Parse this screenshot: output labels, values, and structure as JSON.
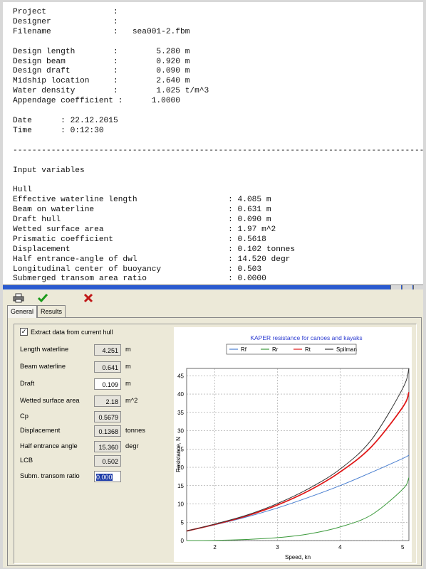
{
  "report": {
    "lines": [
      "Project              :",
      "Designer             :",
      "Filename             :   sea001-2.fbm",
      "",
      "Design length        :        5.280 m",
      "Design beam          :        0.920 m",
      "Design draft         :        0.090 m",
      "Midship location     :        2.640 m",
      "Water density        :        1.025 t/m^3",
      "Appendage coefficient :      1.0000",
      "",
      "Date      : 22.12.2015",
      "Time      : 0:12:30",
      "",
      "----------------------------------------------------------------------------------------------------",
      "",
      "Input variables",
      "",
      "Hull",
      "Effective waterline length                   : 4.085 m",
      "Beam on waterline                            : 0.631 m",
      "Draft hull                                   : 0.090 m",
      "Wetted surface area                          : 1.97 m^2",
      "Prismatic coefficient                        : 0.5618",
      "Displacement                                 : 0.102 tonnes",
      "Half entrance-angle of dwl                   : 14.520 degr",
      "Longitudinal center of buoyancy              : 0.503",
      "Submerged transom area ratio                 : 0.0000"
    ]
  },
  "dialog": {
    "title": "KAPER resistance calculation",
    "toolbar": {
      "print_icon": "printer-icon",
      "ok_icon": "checkmark-icon",
      "cancel_icon": "cross-icon"
    },
    "tabs": [
      "General",
      "Results"
    ],
    "active_tab": "General",
    "extract_label": "Extract data from current hull",
    "extract_checked": true,
    "fields": [
      {
        "label": "Length waterline",
        "value": "4.251",
        "unit": "m",
        "editable": false
      },
      {
        "label": "Beam waterline",
        "value": "0.641",
        "unit": "m",
        "editable": false
      },
      {
        "label": "Draft",
        "value": "0.109",
        "unit": "m",
        "editable": true
      },
      {
        "label": "Wetted surface area",
        "value": "2.18",
        "unit": "m^2",
        "editable": false
      },
      {
        "label": "Cp",
        "value": "0.5679",
        "unit": "",
        "editable": false
      },
      {
        "label": "Displacement",
        "value": "0.1368",
        "unit": "tonnes",
        "editable": false
      },
      {
        "label": "Half entrance angle",
        "value": "15.360",
        "unit": "degr",
        "editable": false
      },
      {
        "label": "LCB",
        "value": "0.502",
        "unit": "",
        "editable": false
      },
      {
        "label": "Subm. transom ratio",
        "value": "0.000",
        "unit": "",
        "editable": true
      }
    ]
  },
  "chart_data": {
    "type": "line",
    "title": "KAPER resistance for canoes and kayaks",
    "xlabel": "Speed, kn",
    "ylabel": "Resistance, N",
    "xlim": [
      1.55,
      5.1
    ],
    "ylim": [
      0,
      47
    ],
    "xticks": [
      2,
      3,
      4,
      5
    ],
    "yticks": [
      0,
      5,
      10,
      15,
      20,
      25,
      30,
      35,
      40,
      45
    ],
    "grid": true,
    "legend_position": "top",
    "x": [
      1.55,
      2.0,
      2.5,
      3.0,
      3.5,
      4.0,
      4.5,
      5.0,
      5.1
    ],
    "series": [
      {
        "name": "Rf",
        "color": "#4a7fd0",
        "values": [
          2.6,
          4.3,
          6.4,
          8.9,
          11.8,
          15.0,
          18.6,
          22.4,
          23.3
        ]
      },
      {
        "name": "Rr",
        "color": "#3c9a3c",
        "values": [
          0.0,
          0.05,
          0.3,
          0.8,
          1.8,
          3.7,
          7.0,
          14.0,
          17.2
        ]
      },
      {
        "name": "Rt",
        "color": "#e01818",
        "values": [
          2.6,
          4.4,
          6.7,
          9.7,
          13.6,
          18.7,
          25.6,
          36.4,
          40.5
        ]
      },
      {
        "name": "Spilman",
        "color": "#333333",
        "values": [
          2.6,
          4.5,
          6.9,
          10.1,
          14.2,
          19.5,
          27.5,
          41.5,
          47.0
        ]
      }
    ]
  }
}
